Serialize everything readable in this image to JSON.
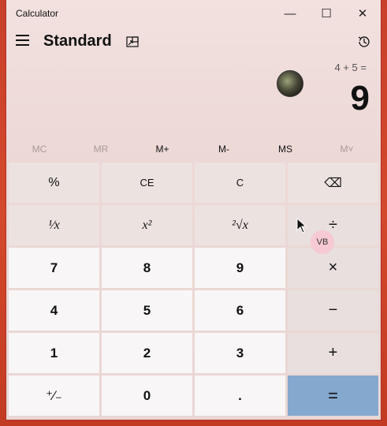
{
  "window": {
    "title": "Calculator",
    "minimize_glyph": "—",
    "maximize_glyph": "☐",
    "close_glyph": "✕"
  },
  "header": {
    "mode": "Standard"
  },
  "display": {
    "expression": "4 + 5 =",
    "result": "9"
  },
  "memory": [
    "MC",
    "MR",
    "M+",
    "M-",
    "MS",
    "M˅"
  ],
  "keys": {
    "percent": "%",
    "ce": "CE",
    "c": "C",
    "backspace": "⌫",
    "reciprocal": "¹⁄x",
    "square": "x²",
    "sqrt": "²√x",
    "divide": "÷",
    "seven": "7",
    "eight": "8",
    "nine": "9",
    "multiply": "×",
    "four": "4",
    "five": "5",
    "six": "6",
    "minus": "−",
    "one": "1",
    "two": "2",
    "three": "3",
    "plus": "+",
    "negate": "⁺⁄₋",
    "zero": "0",
    "decimal": ".",
    "equals": "="
  },
  "badge": "VB",
  "colors": {
    "equals_bg": "#85a8cf",
    "desktop_bg": "#c9402a"
  }
}
